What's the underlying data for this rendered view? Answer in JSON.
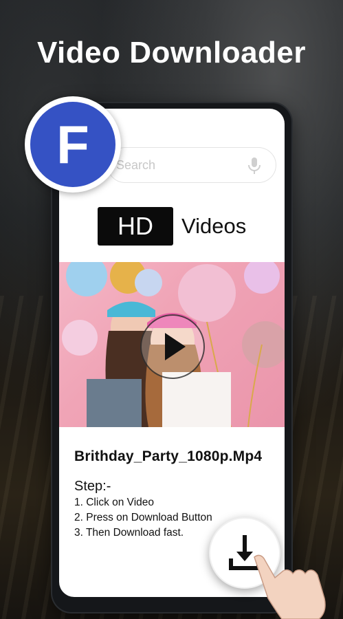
{
  "headline": "Video Downloader",
  "facebook_badge": {
    "letter": "F",
    "color": "#3552c4"
  },
  "search": {
    "placeholder": "Search",
    "icon": "mic-icon"
  },
  "hd_banner": {
    "badge": "HD",
    "label": "Videos"
  },
  "video": {
    "file_name": "Brithday_Party_1080p.Mp4",
    "icon": "play-icon"
  },
  "steps": {
    "title": "Step:-",
    "items": [
      "1. Click on Video",
      "2. Press on Download Button",
      "3. Then Download fast."
    ]
  },
  "download_button": {
    "icon": "download-icon"
  }
}
